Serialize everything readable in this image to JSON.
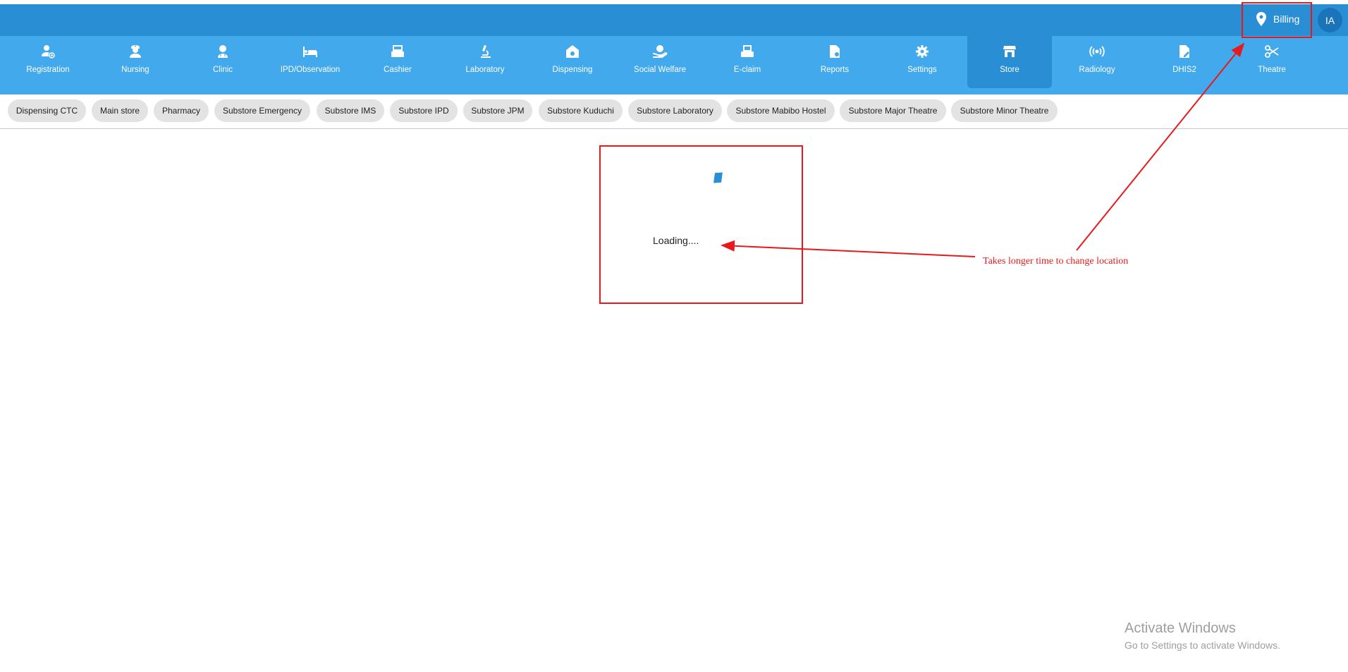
{
  "header": {
    "location_label": "Billing",
    "avatar_initials": "IA",
    "brand_color": "#2a8ed4"
  },
  "nav": {
    "items": [
      {
        "label": "Registration",
        "icon": "user-add-icon"
      },
      {
        "label": "Nursing",
        "icon": "nurse-icon"
      },
      {
        "label": "Clinic",
        "icon": "doctor-icon"
      },
      {
        "label": "IPD/Observation",
        "icon": "bed-icon"
      },
      {
        "label": "Cashier",
        "icon": "cash-register-icon"
      },
      {
        "label": "Laboratory",
        "icon": "microscope-icon"
      },
      {
        "label": "Dispensing",
        "icon": "pharmacy-icon"
      },
      {
        "label": "Social Welfare",
        "icon": "hand-heart-icon"
      },
      {
        "label": "E-claim",
        "icon": "printer-icon"
      },
      {
        "label": "Reports",
        "icon": "report-icon"
      },
      {
        "label": "Settings",
        "icon": "gear-icon"
      },
      {
        "label": "Store",
        "icon": "store-icon",
        "active": true
      },
      {
        "label": "Radiology",
        "icon": "radiation-icon"
      },
      {
        "label": "DHIS2",
        "icon": "file-edit-icon"
      },
      {
        "label": "Theatre",
        "icon": "scissors-icon"
      }
    ]
  },
  "store_tabs": [
    "Dispensing CTC",
    "Main store",
    "Pharmacy",
    "Substore Emergency",
    "Substore IMS",
    "Substore IPD",
    "Substore JPM",
    "Substore Kuduchi",
    "Substore Laboratory",
    "Substore Mabibo Hostel",
    "Substore Major Theatre",
    "Substore Minor Theatre"
  ],
  "main": {
    "loading_text": "Loading...."
  },
  "annotation": {
    "note": "Takes longer time to change location",
    "color": "#e8191c"
  },
  "watermark": {
    "title": "Activate Windows",
    "subtitle": "Go to Settings to activate Windows."
  }
}
